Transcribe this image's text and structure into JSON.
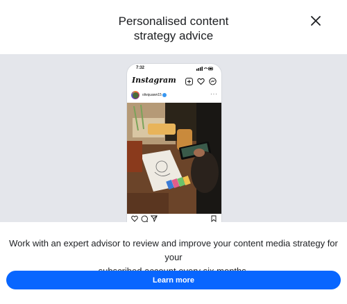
{
  "dialog": {
    "title_line1": "Personalised content",
    "title_line2": "strategy advice",
    "close_icon": "close-icon"
  },
  "phone": {
    "status_time": "7:32",
    "app_name": "Instagram",
    "username": "olivquawn15",
    "icons": [
      "add-post-icon",
      "heart-icon",
      "messenger-icon"
    ]
  },
  "body": {
    "description_line1": "Work with an expert advisor to review and improve your content media strategy for your",
    "description_line2": "subscribed account every six months."
  },
  "cta": {
    "label": "Learn more",
    "color": "#0866ff"
  }
}
